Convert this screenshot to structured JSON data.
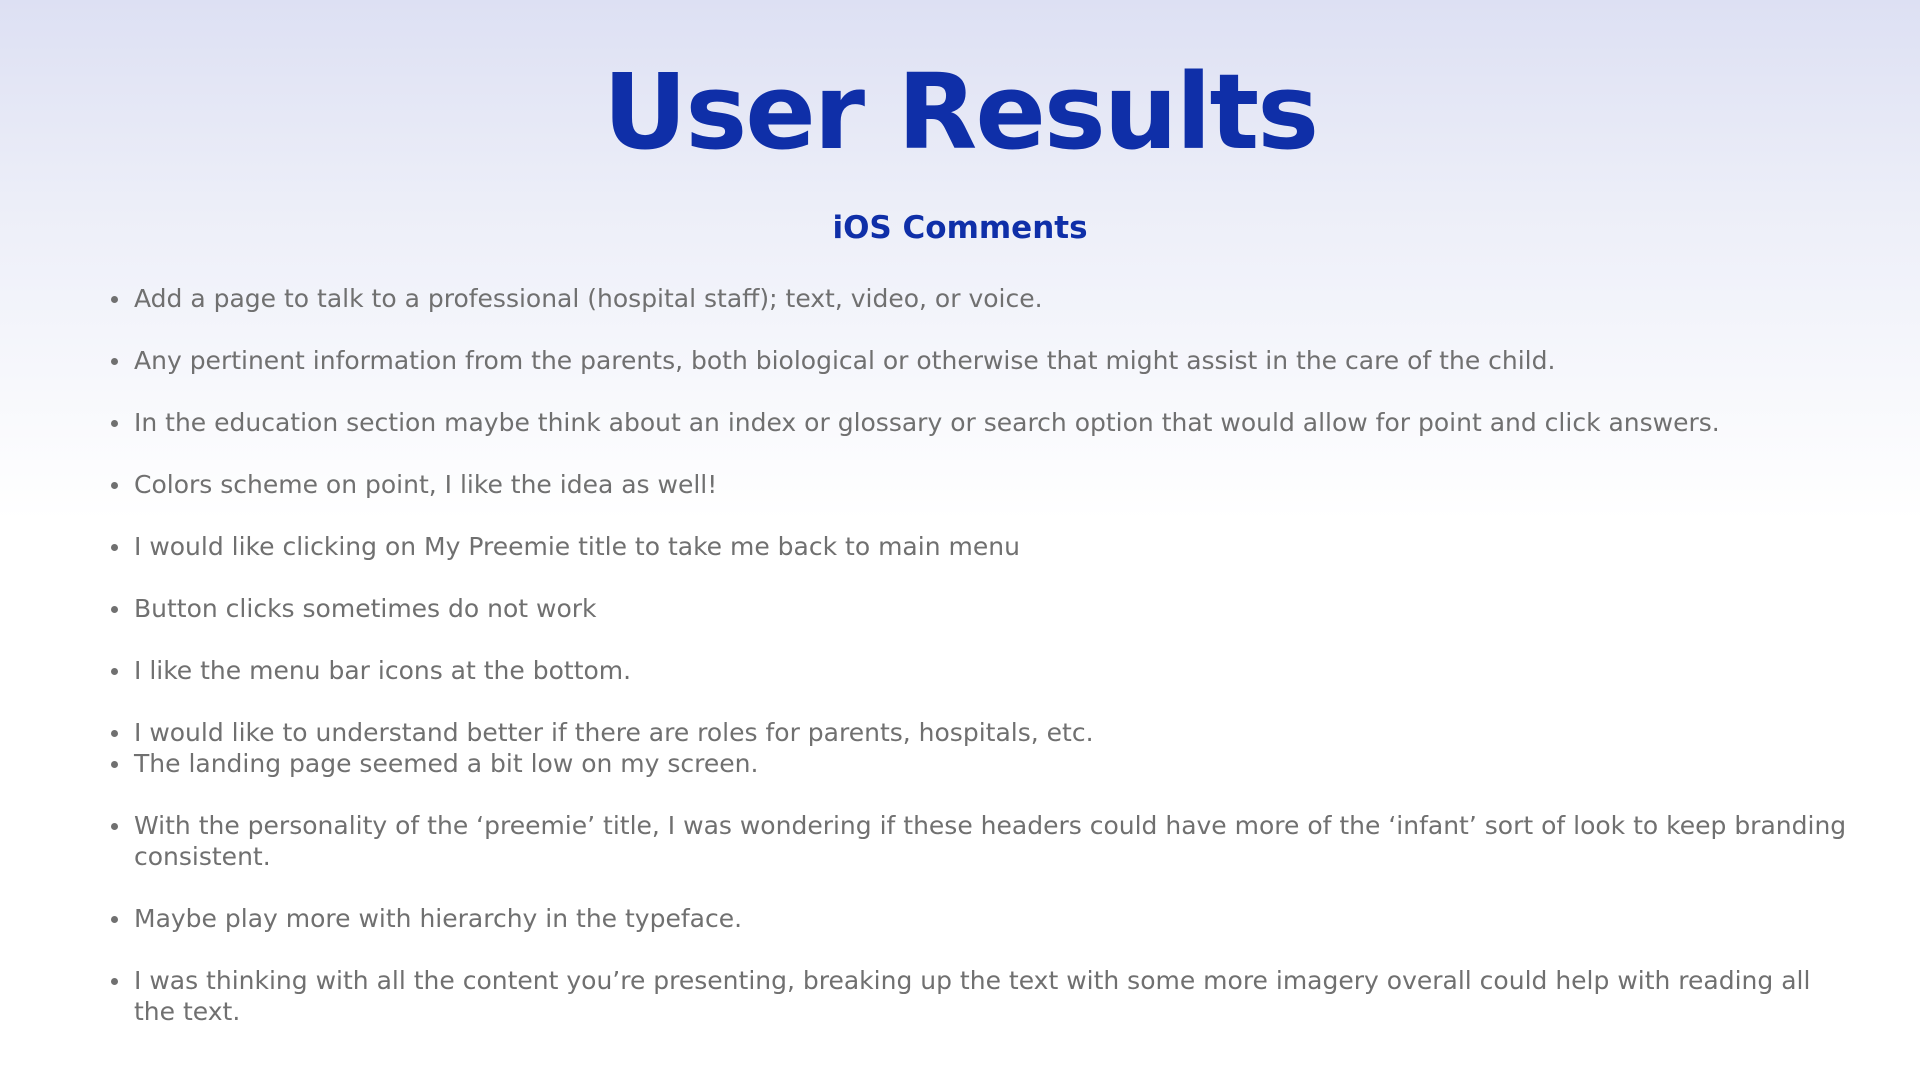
{
  "slide": {
    "title": "User Results",
    "subtitle": "iOS Comments",
    "comments": [
      "Add a page to talk to a professional (hospital staff); text, video, or voice.",
      "Any pertinent information from the parents, both biological or otherwise that might assist in the care of the child.",
      "In the education section maybe think about an index or glossary or search option that would allow for point and click answers.",
      "Colors scheme on point, I like the idea as well!",
      "I would like clicking on My Preemie title to take me back to main menu",
      "Button clicks sometimes do not work",
      "I like the menu bar icons at the bottom.",
      "I would like to understand better if there are roles for parents, hospitals, etc.",
      "The landing page seemed a bit low on my screen.",
      "With the personality of the ‘preemie’ title, I was wondering if these headers could have more of the ‘infant’ sort of look to keep branding consistent.",
      "Maybe play more with hierarchy in the typeface.",
      "I was thinking with all the content you’re presenting, breaking up the text with some more imagery overall could help with reading all the text."
    ]
  },
  "colors": {
    "heading": "#0f2fa8",
    "body_text": "#707070",
    "background_top": "#dde0f3",
    "background_bottom": "#ffffff"
  }
}
